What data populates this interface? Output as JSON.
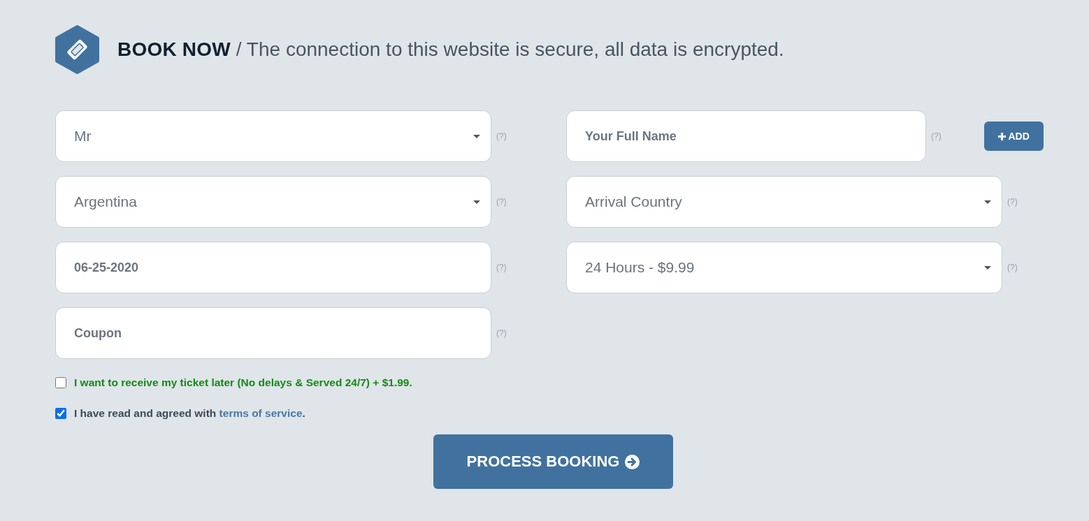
{
  "header": {
    "title": "BOOK NOW",
    "subtitle": "/ The connection to this website is secure, all data is encrypted."
  },
  "fields": [
    {
      "kind": "select",
      "value": "Mr",
      "help": "(?)"
    },
    {
      "kind": "input",
      "placeholder": "Your Full Name",
      "help": "(?)",
      "button": "ADD"
    },
    {
      "kind": "select",
      "value": "Argentina",
      "help": "(?)"
    },
    {
      "kind": "select",
      "value": "Arrival Country",
      "help": "(?)"
    },
    {
      "kind": "input",
      "value": "06-25-2020",
      "help": "(?)"
    },
    {
      "kind": "select",
      "value": "24 Hours - $9.99",
      "help": "(?)"
    },
    {
      "kind": "input",
      "placeholder": "Coupon",
      "help": "(?)"
    }
  ],
  "options": [
    {
      "kind": "offer",
      "label": "I want to receive my ticket later (No delays & Served 24/7) + $1.99.",
      "checked": false
    },
    {
      "kind": "terms",
      "label": "I have read and agreed with",
      "link": "terms of service",
      "tail": ".",
      "checked": true
    }
  ],
  "submit": {
    "label": "PROCESS BOOKING"
  }
}
